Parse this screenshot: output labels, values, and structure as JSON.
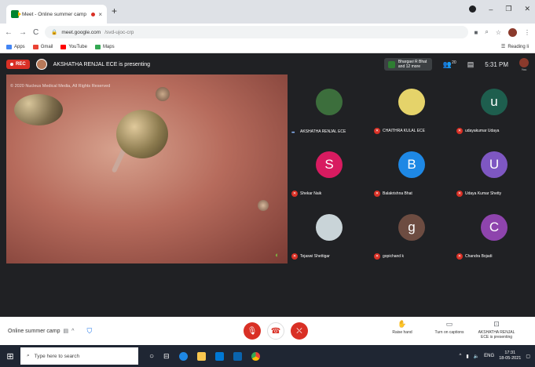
{
  "browser": {
    "tab_title": "Meet - Online summer camp",
    "tab_close": "×",
    "new_tab": "+",
    "url_host": "meet.google.com",
    "url_path": "/svd-ujoc-crp",
    "nav": {
      "back": "←",
      "forward": "→",
      "reload": "C"
    }
  },
  "bookmarks": [
    {
      "label": "Apps",
      "color": "#4285f4"
    },
    {
      "label": "Gmail",
      "color": "#ea4335"
    },
    {
      "label": "YouTube",
      "color": "#ff0000"
    },
    {
      "label": "Maps",
      "color": "#34a853"
    }
  ],
  "reading_list": "Reading li",
  "meet": {
    "rec_label": "REC",
    "presenting_text": "AKSHATHA RENJAL ECE is presenting",
    "mini_tile_text": "Bhargavi R Bhat and 12 more",
    "people_count": "20",
    "time": "5:31 PM",
    "you_label": "You",
    "copyright": "© 2020 Nucleus Medical Media, All Rights Reserved"
  },
  "participants": [
    {
      "name": "AKSHATHA RENJAL ECE",
      "initial": "",
      "color": "#3c6e3c",
      "muted": false
    },
    {
      "name": "CHAITHRA KULAL ECE",
      "initial": "",
      "color": "#e5d36a",
      "muted": true
    },
    {
      "name": "udayakumar Udaya",
      "initial": "u",
      "color": "#1e5e4e",
      "muted": true
    },
    {
      "name": "Shekar Naik",
      "initial": "S",
      "color": "#d81b60",
      "muted": true
    },
    {
      "name": "Balakrishna Bhat",
      "initial": "B",
      "color": "#1e88e5",
      "muted": true
    },
    {
      "name": "Udaya Kumar Shetty",
      "initial": "U",
      "color": "#7e57c2",
      "muted": true
    },
    {
      "name": "Tejaswi Shettigar",
      "initial": "",
      "color": "#c9d4d8",
      "muted": true
    },
    {
      "name": "gopichand k",
      "initial": "g",
      "color": "#6d4c41",
      "muted": true
    },
    {
      "name": "Chandra Bojadi",
      "initial": "C",
      "color": "#8e44ad",
      "muted": true
    }
  ],
  "controls": {
    "meeting_name": "Online summer camp",
    "raise_hand": "Raise hand",
    "captions": "Turn on captions",
    "presenting": "AKSHATHA RENJAL ECE is presenting"
  },
  "taskbar": {
    "search_placeholder": "Type here to search",
    "language": "ENG",
    "time": "17:31",
    "date": "18-05-2021"
  }
}
